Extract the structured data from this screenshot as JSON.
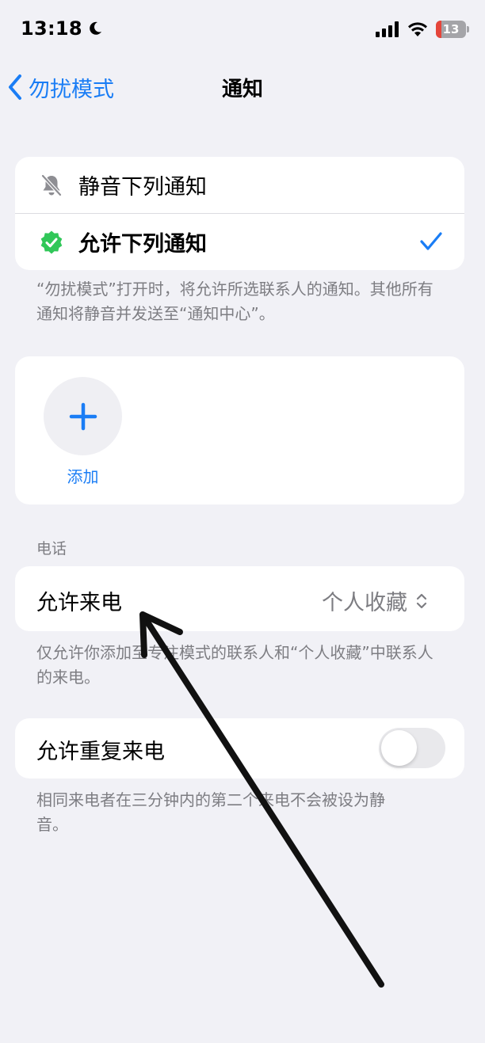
{
  "status": {
    "time": "13:18",
    "battery": "13",
    "icons": [
      "moon-icon",
      "signal-icon",
      "wifi-icon",
      "battery-icon"
    ]
  },
  "nav": {
    "back_label": "勿扰模式",
    "title": "通知"
  },
  "mode_options": [
    {
      "label": "静音下列通知",
      "icon": "bell-slash-icon",
      "selected": false
    },
    {
      "label": "允许下列通知",
      "icon": "verified-check-badge-icon",
      "selected": true
    }
  ],
  "mode_footnote": "“勿扰模式”打开时，将允许所选联系人的通知。其他所有通知将静音并发送至“通知中心”。",
  "add": {
    "label": "添加"
  },
  "phone_section": {
    "header": "电话",
    "allow_calls": {
      "label": "允许来电",
      "value": "个人收藏"
    },
    "allow_calls_footnote": "仅允许你添加至专注模式的联系人和“个人收藏”中联系人的来电。",
    "repeat_calls": {
      "label": "允许重复来电",
      "enabled": false
    },
    "repeat_calls_footnote": "相同来电者在三分钟内的第二个来电不会被设为静音。"
  },
  "colors": {
    "accent": "#1a7df5",
    "background": "#f1f1f6",
    "secondary_text": "#7d7d82",
    "badge_green": "#31c759"
  }
}
